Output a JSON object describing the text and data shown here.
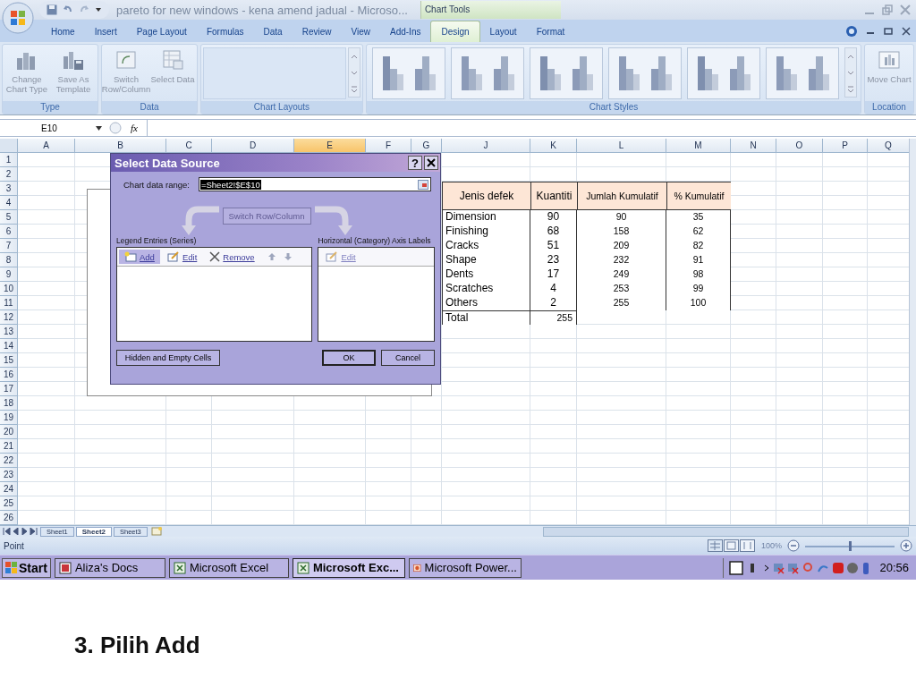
{
  "title_bar": {
    "title": "pareto for new windows - kena amend jadual - Microso...",
    "context_tab": "Chart Tools"
  },
  "ribbon_tabs": [
    {
      "label": "Home",
      "selected": false
    },
    {
      "label": "Insert",
      "selected": false
    },
    {
      "label": "Page Layout",
      "selected": false
    },
    {
      "label": "Formulas",
      "selected": false
    },
    {
      "label": "Data",
      "selected": false
    },
    {
      "label": "Review",
      "selected": false
    },
    {
      "label": "View",
      "selected": false
    },
    {
      "label": "Add-Ins",
      "selected": false
    }
  ],
  "chart_tools_tabs": [
    {
      "label": "Design",
      "selected": true
    },
    {
      "label": "Layout",
      "selected": false
    },
    {
      "label": "Format",
      "selected": false
    }
  ],
  "ribbon_groups": [
    {
      "label": "Type",
      "kind": "buttons",
      "buttons": [
        {
          "label": "Change Chart Type",
          "kind": "chart"
        },
        {
          "label": "Save As Template",
          "kind": "template"
        }
      ]
    },
    {
      "label": "Data",
      "kind": "buttons",
      "buttons": [
        {
          "label": "Switch Row/Column",
          "kind": "switch"
        },
        {
          "label": "Select Data",
          "kind": "select"
        }
      ]
    },
    {
      "label": "Chart Layouts",
      "kind": "gallery"
    },
    {
      "label": "Chart Styles",
      "kind": "styles"
    },
    {
      "label": "Location",
      "kind": "buttons",
      "buttons": [
        {
          "label": "Move Chart",
          "kind": "move"
        }
      ]
    }
  ],
  "formula_bar": {
    "name_box": "E10",
    "function_label": "fx"
  },
  "columns": [
    {
      "label": "A",
      "selected": false
    },
    {
      "label": "B",
      "selected": false
    },
    {
      "label": "C",
      "selected": false
    },
    {
      "label": "D",
      "selected": false
    },
    {
      "label": "E",
      "selected": true
    },
    {
      "label": "F",
      "selected": false
    },
    {
      "label": "G",
      "selected": false
    },
    {
      "label": "J",
      "selected": false
    },
    {
      "label": "K",
      "selected": false
    },
    {
      "label": "L",
      "selected": false
    },
    {
      "label": "M",
      "selected": false
    },
    {
      "label": "N",
      "selected": false
    },
    {
      "label": "O",
      "selected": false
    },
    {
      "label": "P",
      "selected": false
    },
    {
      "label": "Q",
      "selected": false
    }
  ],
  "rows": [
    "1",
    "2",
    "3",
    "4",
    "5",
    "6",
    "7",
    "8",
    "9",
    "10",
    "11",
    "12",
    "13",
    "14",
    "15",
    "16",
    "17",
    "18",
    "19",
    "20",
    "21",
    "22",
    "23",
    "24",
    "25",
    "26"
  ],
  "table": {
    "columns": [
      "Jenis defek",
      "Kuantiti",
      "Jumlah Kumulatif",
      "% Kumulatif"
    ],
    "rows": [
      [
        "Dimension",
        "90",
        "90",
        "35"
      ],
      [
        "Finishing",
        "68",
        "158",
        "62"
      ],
      [
        "Cracks",
        "51",
        "209",
        "82"
      ],
      [
        "Shape",
        "23",
        "232",
        "91"
      ],
      [
        "Dents",
        "17",
        "249",
        "98"
      ],
      [
        "Scratches",
        "4",
        "253",
        "99"
      ],
      [
        "Others",
        "2",
        "255",
        "100"
      ]
    ],
    "total": {
      "label": "Total",
      "value": "255"
    }
  },
  "dialog": {
    "title": "Select Data Source",
    "help": "?",
    "range_label": "Chart data range:",
    "range_value": "=Sheet2!$E$10",
    "switch_button": {
      "label": "Switch Row/Column",
      "disabled": true
    },
    "legend_label": "Legend Entries (Series)",
    "legend_toolbar": [
      {
        "label": "Add",
        "kind": "add",
        "selected": true
      },
      {
        "label": "Edit",
        "kind": "edit",
        "selected": false
      },
      {
        "label": "Remove",
        "kind": "remove",
        "selected": false
      }
    ],
    "axis_label": "Horizontal (Category) Axis Labels",
    "axis_toolbar": [
      {
        "label": "Edit",
        "kind": "edit",
        "selected": false
      }
    ],
    "hidden_button": "Hidden and Empty Cells",
    "ok_button": "OK",
    "cancel_button": "Cancel"
  },
  "sheet_tabs": [
    {
      "label": "Sheet1",
      "selected": false
    },
    {
      "label": "Sheet2",
      "selected": true
    },
    {
      "label": "Sheet3",
      "selected": false
    }
  ],
  "status_bar": {
    "mode": "Point",
    "zoom": {
      "label": "100%",
      "level": 0.5
    }
  },
  "taskbar": {
    "start": "Start",
    "tasks": [
      {
        "label": "Aliza's Docs",
        "kind": "docs",
        "selected": false
      },
      {
        "label": "Microsoft Excel",
        "kind": "excel",
        "selected": false
      },
      {
        "label": "Microsoft Exc...",
        "kind": "excel",
        "selected": true
      },
      {
        "label": "Microsoft Power...",
        "kind": "powerpoint",
        "selected": false
      }
    ],
    "clock": "20:56"
  },
  "caption": "3. Pilih Add"
}
